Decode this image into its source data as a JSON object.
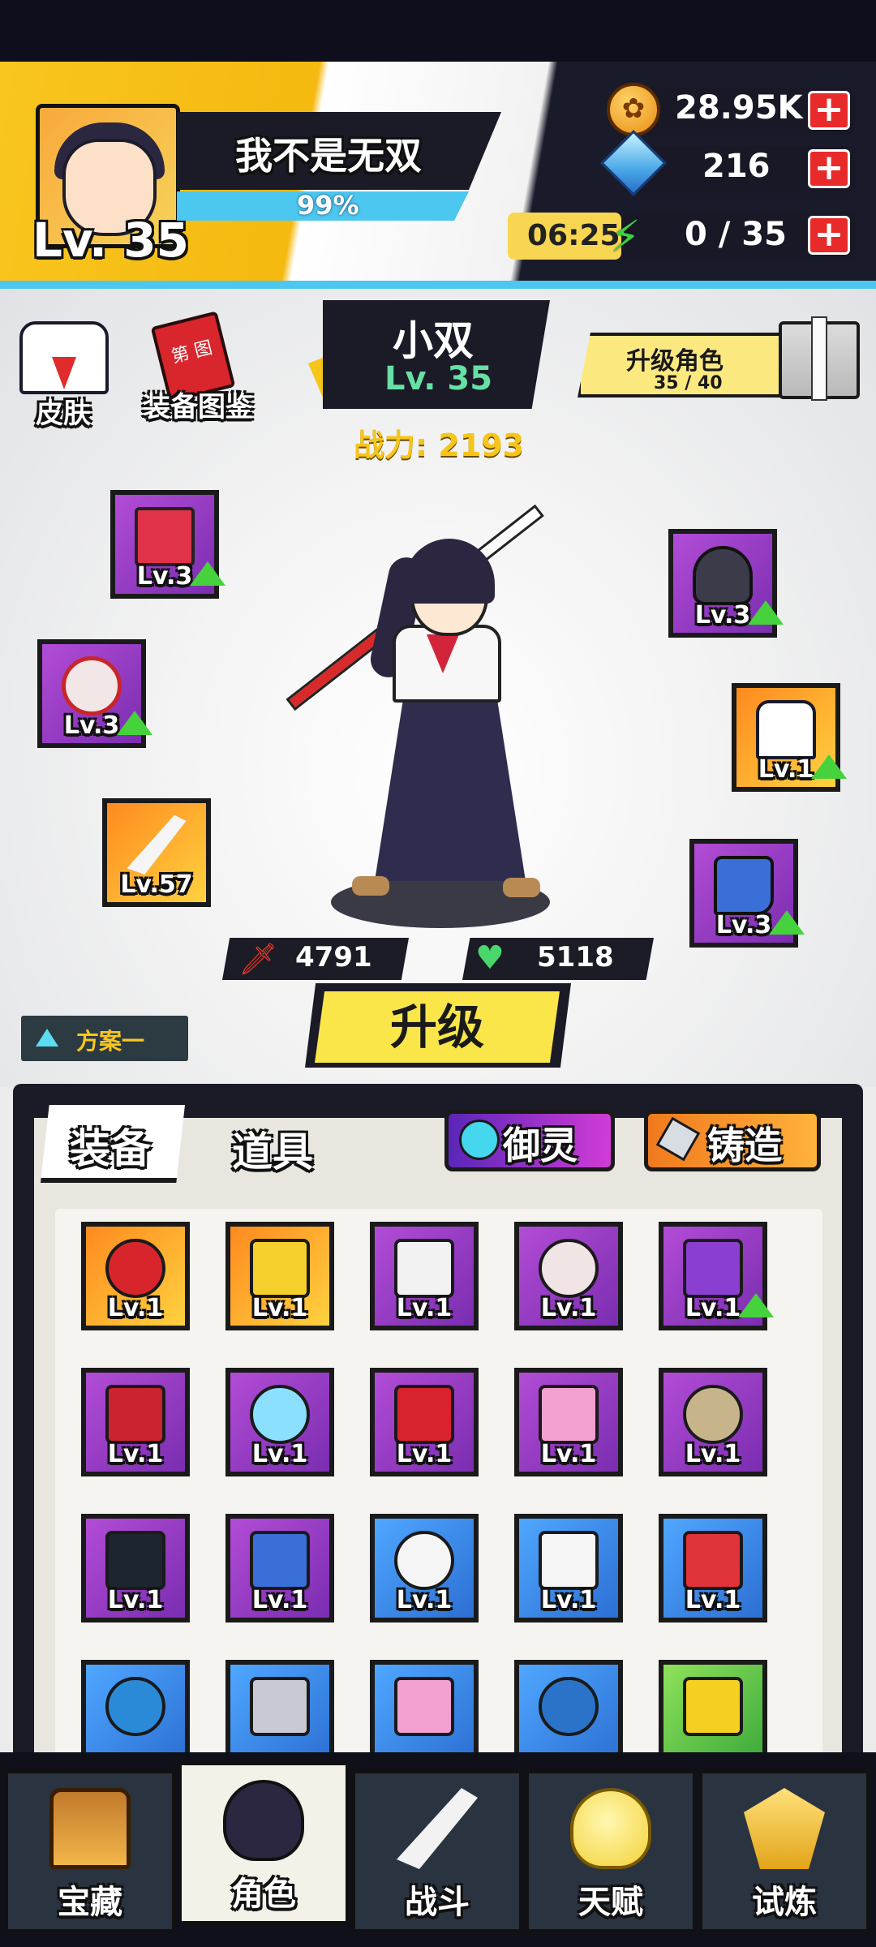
{
  "player": {
    "name": "我不是无双",
    "level": "Lv. 35",
    "xp_percent": "99%"
  },
  "resources": {
    "gold": "28.95K",
    "gems": "216",
    "stamina": "0 / 35",
    "stamina_timer": "06:25",
    "plus": "+"
  },
  "left_menu": {
    "skin": "皮肤",
    "codex": "装备图鉴",
    "codex_book_text": "第\n图"
  },
  "character": {
    "name": "小双",
    "level": "Lv. 35",
    "power": "战力: 2193",
    "upgrade_banner": "升级角色",
    "upgrade_progress": "35 / 40",
    "attack": "4791",
    "hp": "5118"
  },
  "equipped": [
    {
      "name": "book",
      "level": "Lv.3",
      "upgradable": true
    },
    {
      "name": "ring",
      "level": "Lv.3",
      "upgradable": true
    },
    {
      "name": "blade",
      "level": "Lv.57",
      "upgradable": false
    },
    {
      "name": "helmet",
      "level": "Lv.3",
      "upgradable": true
    },
    {
      "name": "uniform",
      "level": "Lv.1",
      "upgradable": true
    },
    {
      "name": "boots",
      "level": "Lv.3",
      "upgradable": true
    }
  ],
  "actions": {
    "upgrade": "升级",
    "plan": "方案一"
  },
  "inventory": {
    "tab_equipment": "装备",
    "tab_items": "道具",
    "yuling": "御灵",
    "forge": "铸造",
    "items": [
      {
        "name": "red-blade",
        "level": "Lv.1",
        "rarity": "orange"
      },
      {
        "name": "banana-blade",
        "level": "Lv.1",
        "rarity": "orange"
      },
      {
        "name": "white-blade",
        "level": "Lv.1",
        "rarity": "purple"
      },
      {
        "name": "talisman-ring",
        "level": "Lv.1",
        "rarity": "purple"
      },
      {
        "name": "orb-ring",
        "level": "Lv.1",
        "rarity": "purple",
        "upgradable": true
      },
      {
        "name": "bead-necklace",
        "level": "Lv.1",
        "rarity": "purple"
      },
      {
        "name": "crystal-shard",
        "level": "Lv.1",
        "rarity": "purple"
      },
      {
        "name": "red-scarf",
        "level": "Lv.1",
        "rarity": "purple"
      },
      {
        "name": "pink-helmet",
        "level": "Lv.1",
        "rarity": "purple"
      },
      {
        "name": "field-jacket",
        "level": "Lv.1",
        "rarity": "purple"
      },
      {
        "name": "dark-boots",
        "level": "Lv.1",
        "rarity": "purple"
      },
      {
        "name": "blue-boots",
        "level": "Lv.1",
        "rarity": "purple"
      },
      {
        "name": "blue-blade-1",
        "level": "Lv.1",
        "rarity": "blue"
      },
      {
        "name": "blue-blade-2",
        "level": "Lv.1",
        "rarity": "blue"
      },
      {
        "name": "red-ring-blue",
        "level": "Lv.1",
        "rarity": "blue"
      },
      {
        "name": "gold-necklace",
        "level": "",
        "rarity": "blue"
      },
      {
        "name": "spiked-crown",
        "level": "",
        "rarity": "blue"
      },
      {
        "name": "pink-helmet-blue",
        "level": "",
        "rarity": "blue"
      },
      {
        "name": "blue-slipper",
        "level": "",
        "rarity": "blue"
      },
      {
        "name": "banana-green",
        "level": "",
        "rarity": "green"
      }
    ]
  },
  "nav": [
    {
      "label": "宝藏",
      "icon": "treasure-chest-icon"
    },
    {
      "label": "角色",
      "icon": "character-portrait-icon",
      "active": true
    },
    {
      "label": "战斗",
      "icon": "crossed-swords-icon"
    },
    {
      "label": "天赋",
      "icon": "lightbulb-icon"
    },
    {
      "label": "试炼",
      "icon": "trial-emblem-icon"
    }
  ]
}
